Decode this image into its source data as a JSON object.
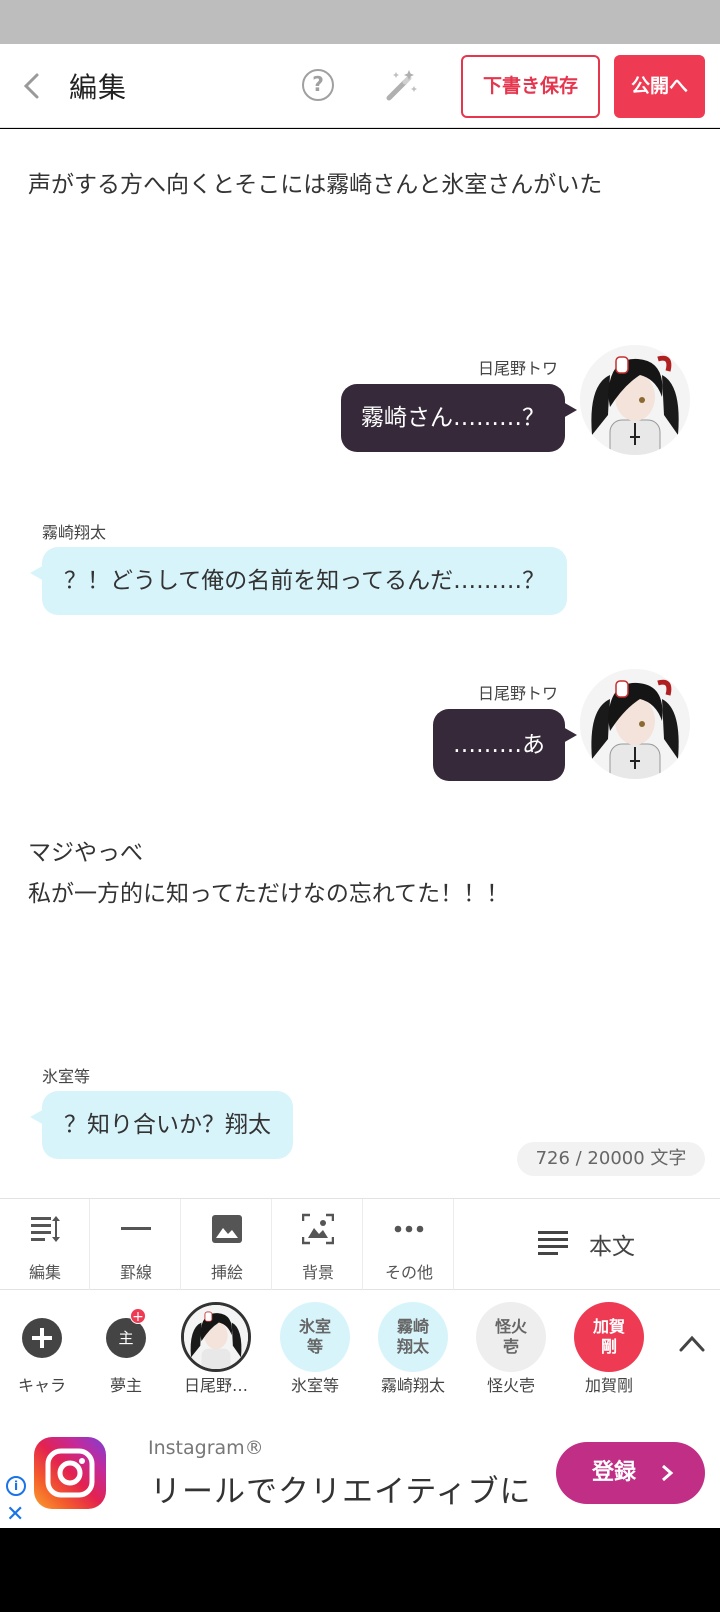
{
  "header": {
    "title": "編集",
    "help_label": "?",
    "draft_button": "下書き保存",
    "publish_button": "公開へ"
  },
  "story": {
    "narration_1": "声がする方へ向くとそこには霧崎さんと氷室さんがいた",
    "msg_1": {
      "speaker": "日尾野トワ",
      "text": "霧崎さん………？"
    },
    "msg_2": {
      "speaker": "霧崎翔太",
      "text": "？！どうして俺の名前を知ってるんだ………？"
    },
    "msg_3": {
      "speaker": "日尾野トワ",
      "text": "………あ"
    },
    "narration_2_line1": "マジやっべ",
    "narration_2_line2": "私が一方的に知ってただけなの忘れてた！！！",
    "msg_4": {
      "speaker": "氷室等",
      "text": "？知り合いか？翔太"
    },
    "counter": "726 / 20000 文字"
  },
  "toolbar": {
    "edit": "編集",
    "rule": "罫線",
    "illustration": "挿絵",
    "background": "背景",
    "other": "その他",
    "body_text": "本文"
  },
  "characters": {
    "add_label": "キャラ",
    "dream_label": "夢主",
    "dream_icon_text": "主",
    "items": [
      {
        "label": "日尾野…"
      },
      {
        "label": "氷室等",
        "chip": "氷室\n等",
        "color": "#d8f4fb",
        "text_color": "#666666"
      },
      {
        "label": "霧崎翔太",
        "chip": "霧崎\n翔太",
        "color": "#d8f4fb",
        "text_color": "#666666"
      },
      {
        "label": "怪火壱",
        "chip": "怪火\n壱",
        "color": "#eeeeee",
        "text_color": "#666666"
      },
      {
        "label": "加賀剛",
        "chip": "加賀\n剛",
        "color": "#ee3a52",
        "text_color": "#ffffff"
      }
    ]
  },
  "ad": {
    "brand": "Instagram®",
    "headline": "リールでクリエイティブに",
    "cta": "登録",
    "info": "i",
    "close": "✕"
  },
  "colors": {
    "accent": "#ee3a52",
    "dark_bubble": "#36293a",
    "light_bubble": "#d8f4fb",
    "ad_button": "#c02e86"
  }
}
